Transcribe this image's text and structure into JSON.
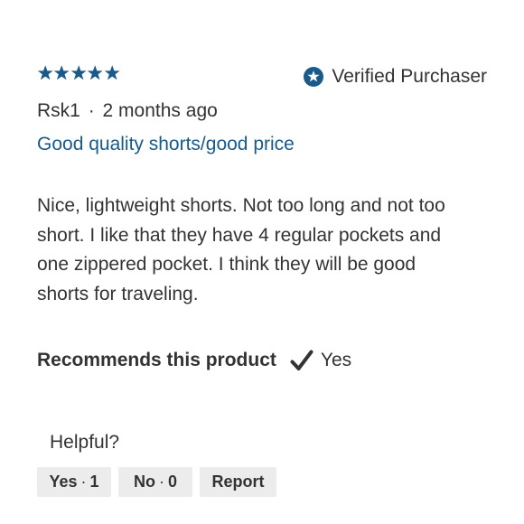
{
  "review": {
    "rating": 5,
    "max_rating": 5,
    "star_color": "#1a5a8a",
    "verified_label": "Verified Purchaser",
    "verified_icon": "star-badge-icon",
    "reviewer_name": "Rsk1",
    "separator": "·",
    "posted_ago": "2 months ago",
    "title": "Good quality shorts/good price",
    "title_color": "#1a5a8a",
    "body": "Nice, lightweight shorts. Not too long and not too short. I like that they have 4 regular pockets and one zippered pocket. I think they will be good shorts for traveling."
  },
  "recommendation": {
    "label": "Recommends this product",
    "icon": "checkmark-icon",
    "answer": "Yes"
  },
  "helpful": {
    "label": "Helpful?",
    "yes_label": "Yes",
    "yes_count": "1",
    "no_label": "No",
    "no_count": "0",
    "report_label": "Report",
    "button_bg": "#ececec"
  }
}
